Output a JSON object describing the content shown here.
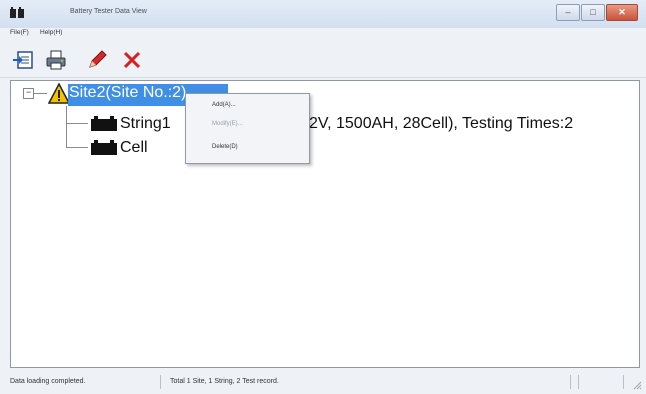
{
  "window": {
    "title": "Battery Tester Data View",
    "buttons": [
      "minimize",
      "maximize",
      "close"
    ]
  },
  "menu": {
    "items": [
      "File(F)",
      "Help(H)"
    ]
  },
  "toolbar": {
    "icons": [
      "import-data-icon",
      "print-icon",
      "edit-pen-icon",
      "delete-x-icon"
    ]
  },
  "tree": {
    "site_label": "Site2(Site No.:2)",
    "string_label": "String1",
    "string_detail": "2V, 1500AH, 28Cell), Testing Times:2",
    "cell_label": "Cell"
  },
  "context_menu": {
    "items": [
      {
        "label": "Add(A)...",
        "enabled": true
      },
      {
        "label": "Modify(E)...",
        "enabled": false
      },
      {
        "label": "Delete(D)",
        "enabled": true
      }
    ]
  },
  "status": {
    "left": "Data loading completed.",
    "middle": "Total 1 Site, 1 String, 2 Test record."
  },
  "colors": {
    "selection": "#3f8fe6",
    "warning": "#f2c200",
    "delete": "#d62020"
  }
}
